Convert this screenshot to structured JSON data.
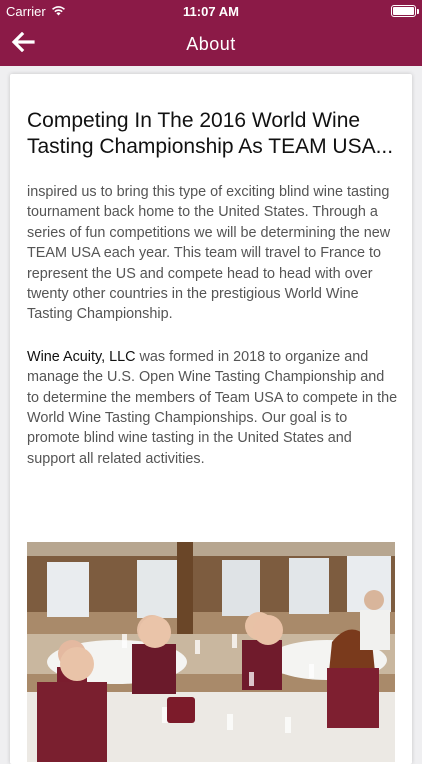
{
  "status_bar": {
    "carrier": "Carrier",
    "time": "11:07 AM"
  },
  "nav": {
    "title": "About"
  },
  "article": {
    "headline": "Competing In The 2016 World Wine Tasting Championship As TEAM USA...",
    "paragraph1": "inspired us to bring this type of exciting blind wine tasting tournament back home to the United States. Through a series of fun competitions we will be determining the new TEAM USA each year. This team will travel to France to represent the US and compete head to head with over twenty other countries in the prestigious World Wine Tasting Championship.",
    "paragraph2_lead": "Wine Acuity, LLC",
    "paragraph2_rest": " was formed in 2018 to organize and manage the U.S. Open Wine Tasting Championship and to determine the members of Team USA to compete in the World Wine Tasting Championships. Our goal is to promote blind wine tasting in the United States and support all related activities."
  },
  "colors": {
    "brand": "#8b1a47",
    "card": "#ffffff",
    "background": "#efeff1"
  }
}
